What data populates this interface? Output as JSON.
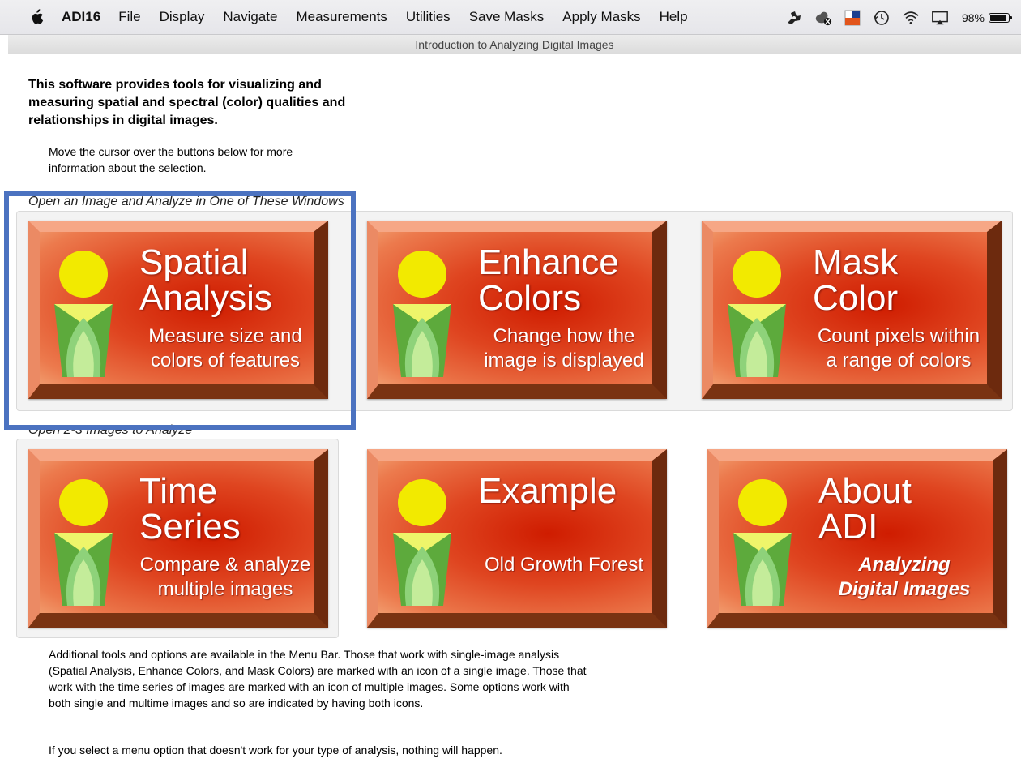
{
  "menubar": {
    "app_name": "ADI16",
    "items": [
      "File",
      "Display",
      "Navigate",
      "Measurements",
      "Utilities",
      "Save Masks",
      "Apply Masks",
      "Help"
    ],
    "battery_percent": "98%",
    "battery_level": 0.98
  },
  "window": {
    "title": "Introduction to Analyzing Digital Images"
  },
  "intro": {
    "headline": "This software provides tools for visualizing and measuring spatial and spectral (color) qualities and relationships in digital images.",
    "instruction": "Move the cursor over the buttons below for more information about the selection."
  },
  "sections": {
    "single": "Open an Image and Analyze in One of These Windows",
    "multi": "Open 2-3 Images to Analyze"
  },
  "buttons": {
    "spatial": {
      "title1": "Spatial",
      "title2": "Analysis",
      "sub1": "Measure size and",
      "sub2": "colors of features"
    },
    "enhance": {
      "title1": "Enhance",
      "title2": "Colors",
      "sub1": "Change how the",
      "sub2": "image is displayed"
    },
    "mask": {
      "title1": "Mask",
      "title2": "Color",
      "sub1": "Count pixels within",
      "sub2": "a range of colors"
    },
    "time": {
      "title1": "Time",
      "title2": "Series",
      "sub1": "Compare & analyze",
      "sub2": "multiple images"
    },
    "example": {
      "title1": "Example",
      "sub1": "Old Growth Forest"
    },
    "about": {
      "title1": "About",
      "title2": "ADI",
      "sub1": "Analyzing",
      "sub2": "Digital Images"
    }
  },
  "footer": {
    "para1": "Additional tools and options are available in the Menu Bar.  Those that work with single-image analysis (Spatial Analysis, Enhance Colors, and Mask Colors) are marked with an icon of a single image.  Those that work with the time series of images are marked with an icon of multiple images.  Some options work with both single and multime images and so are indicated by having both icons.",
    "para2": "If you select a menu option that doesn't work for your type of analysis, nothing will happen."
  },
  "colors": {
    "highlight": "#4b72c0",
    "button_red": "#cf1c00",
    "figure_head": "#f2ea00",
    "figure_green": "#5daa3c"
  }
}
